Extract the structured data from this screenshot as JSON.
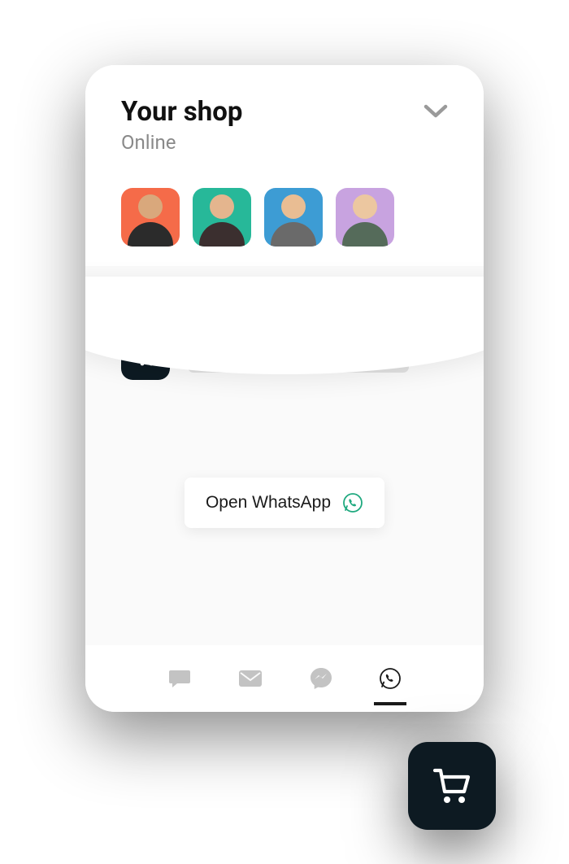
{
  "header": {
    "title": "Your shop",
    "status": "Online"
  },
  "avatars": [
    {
      "bg": "#f56b49"
    },
    {
      "bg": "#27b899"
    },
    {
      "bg": "#3d9cd4"
    },
    {
      "bg": "#c8a3e0"
    }
  ],
  "cta": {
    "label": "Open WhatsApp"
  },
  "tabs": [
    {
      "name": "chat",
      "active": false
    },
    {
      "name": "email",
      "active": false
    },
    {
      "name": "messenger",
      "active": false
    },
    {
      "name": "whatsapp",
      "active": true
    }
  ],
  "colors": {
    "whatsapp": "#1fa97f"
  }
}
